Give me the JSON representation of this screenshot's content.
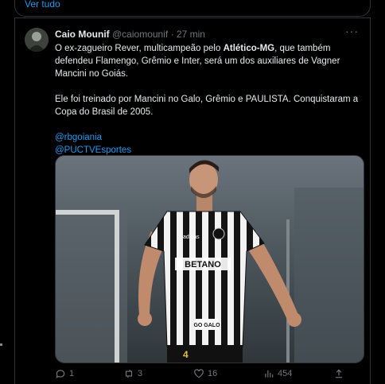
{
  "top": {
    "show_more": "Ver tudo"
  },
  "tweet": {
    "author_name": "Caio Mounif",
    "author_handle": "@caiomounif",
    "separator": "·",
    "time": "27 min",
    "more_icon": "ellipsis-icon",
    "paragraph1": {
      "before": "O ex-zagueiro Rever, multicampeão pelo ",
      "bold": "Atlético-MG",
      "after": ", que também defendeu Flamengo, Grêmio e Inter, será um dos auxiliares de Vagner Mancini no Goiás."
    },
    "paragraph2": "Ele foi treinado por Mancini no Galo, Grêmio e PAULISTA. Conquistaram a Copa do Brasil de 2005.",
    "mention1": "@rbgoiania",
    "mention2": "@PUCTVEsportes",
    "image": {
      "jersey_sponsor": "BETANO",
      "jersey_brand": "adidas",
      "jersey_sponsor2": "GO GALO",
      "jersey_number": "4"
    },
    "actions": {
      "reply_count": "1",
      "retweet_count": "3",
      "like_count": "16",
      "views_count": "454"
    }
  },
  "colors": {
    "accent": "#1d9bf0",
    "muted": "#71767b",
    "text": "#e7e9ea",
    "border": "#2f3336"
  }
}
